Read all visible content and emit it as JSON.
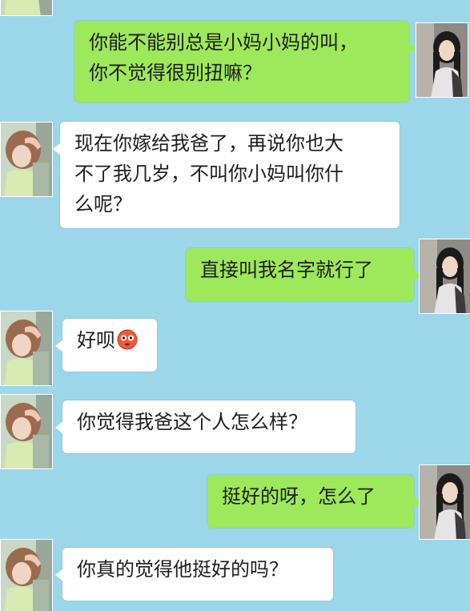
{
  "messages": [
    {
      "from": "me",
      "text": "你能不能别总是小妈小妈的叫，\n你不觉得很别扭嘛？"
    },
    {
      "from": "other",
      "text": "现在你嫁给我爸了，再说你也大\n不了我几岁，不叫你小妈叫你什\n么呢？"
    },
    {
      "from": "me",
      "text": "直接叫我名字就行了"
    },
    {
      "from": "other",
      "text": "好呗",
      "emoji": "flushed-face-emoji"
    },
    {
      "from": "other",
      "text": "你觉得我爸这个人怎么样？"
    },
    {
      "from": "me",
      "text": "挺好的呀，怎么了"
    },
    {
      "from": "other",
      "text": "你真的觉得他挺好的吗？"
    }
  ],
  "colors": {
    "background": "#9bd7e8",
    "outgoing_bubble": "#9ee85b",
    "incoming_bubble": "#ffffff"
  }
}
